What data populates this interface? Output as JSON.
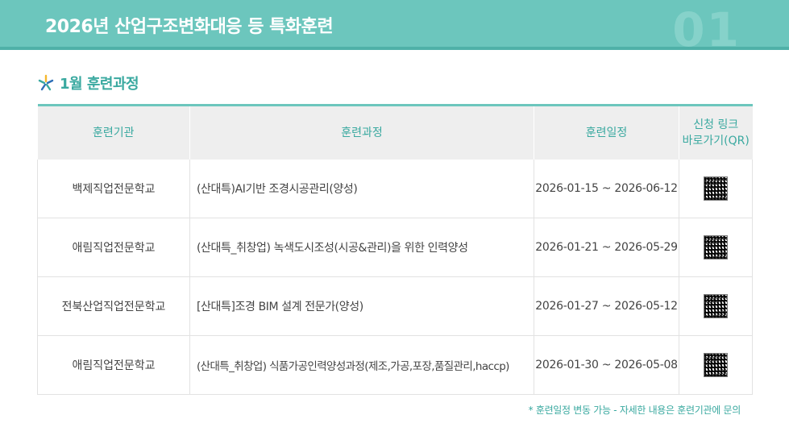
{
  "header": {
    "title": "2026년 산업구조변화대응 등 특화훈련",
    "page_number": "01"
  },
  "section": {
    "title": "1월 훈련과정",
    "icon": "sparkle-icon"
  },
  "table": {
    "columns": [
      "훈련기관",
      "훈련과정",
      "훈련일정",
      "신청 링크\n바로가기(QR)"
    ],
    "rows": [
      {
        "institution": "백제직업전문학교",
        "course": "(산대특)AI기반 조경시공관리(양성)",
        "schedule": "2026-01-15 ~ 2026-06-12"
      },
      {
        "institution": "애림직업전문학교",
        "course": "(산대특_취창업) 녹색도시조성(시공&관리)을 위한 인력양성",
        "schedule": "2026-01-21 ~ 2026-05-29"
      },
      {
        "institution": "전북산업직업전문학교",
        "course": "[산대특]조경 BIM 설계 전문가(양성)",
        "schedule": "2026-01-27 ~ 2026-05-12"
      },
      {
        "institution": "애림직업전문학교",
        "course": "(산대특_취창업) 식품가공인력양성과정(제조,가공,포장,품질관리,haccp)",
        "schedule": "2026-01-30 ~ 2026-05-08"
      }
    ]
  },
  "footnote": "* 훈련일정 변동 가능 - 자세한 내용은 훈련기관에 문의",
  "colors": {
    "accent": "#6cc6bd",
    "accent_text": "#3aa9a0",
    "header_bg": "#eeeeee"
  }
}
